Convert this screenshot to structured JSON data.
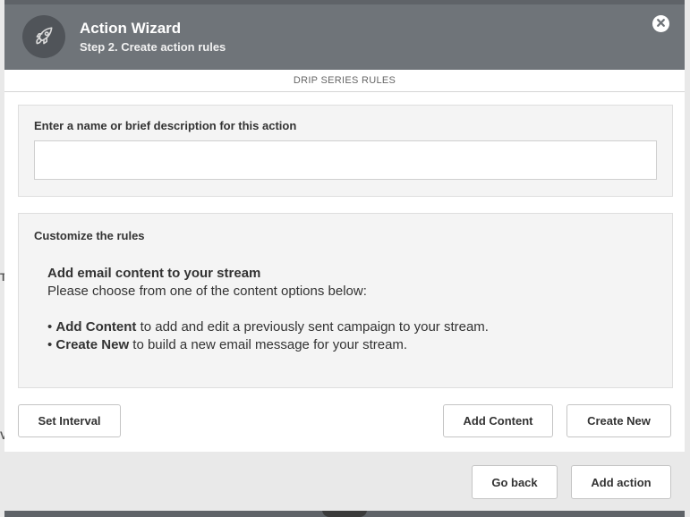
{
  "header": {
    "title": "Action Wizard",
    "subtitle": "Step 2. Create action rules",
    "icon": "rocket-icon",
    "close_icon": "close-icon"
  },
  "tabs": {
    "active_label": "DRIP SERIES RULES"
  },
  "name_section": {
    "label": "Enter a name or brief description for this action",
    "value": ""
  },
  "rules_section": {
    "label": "Customize the rules",
    "heading": "Add email content to your stream",
    "intro": "Please choose from one of the content options below:",
    "bullet_1_strong": "Add Content",
    "bullet_1_text": " to add and edit a previously sent campaign to your stream.",
    "bullet_2_strong": "Create New",
    "bullet_2_text": " to build a new email message for your stream."
  },
  "actions": {
    "set_interval": "Set Interval",
    "add_content": "Add Content",
    "create_new": "Create New"
  },
  "footer": {
    "go_back": "Go back",
    "add_action": "Add action"
  },
  "colors": {
    "header_bg": "#6f7479",
    "icon_circle": "#505459",
    "panel_bg": "#f4f4f4",
    "footer_bg": "#e9e9e9"
  }
}
